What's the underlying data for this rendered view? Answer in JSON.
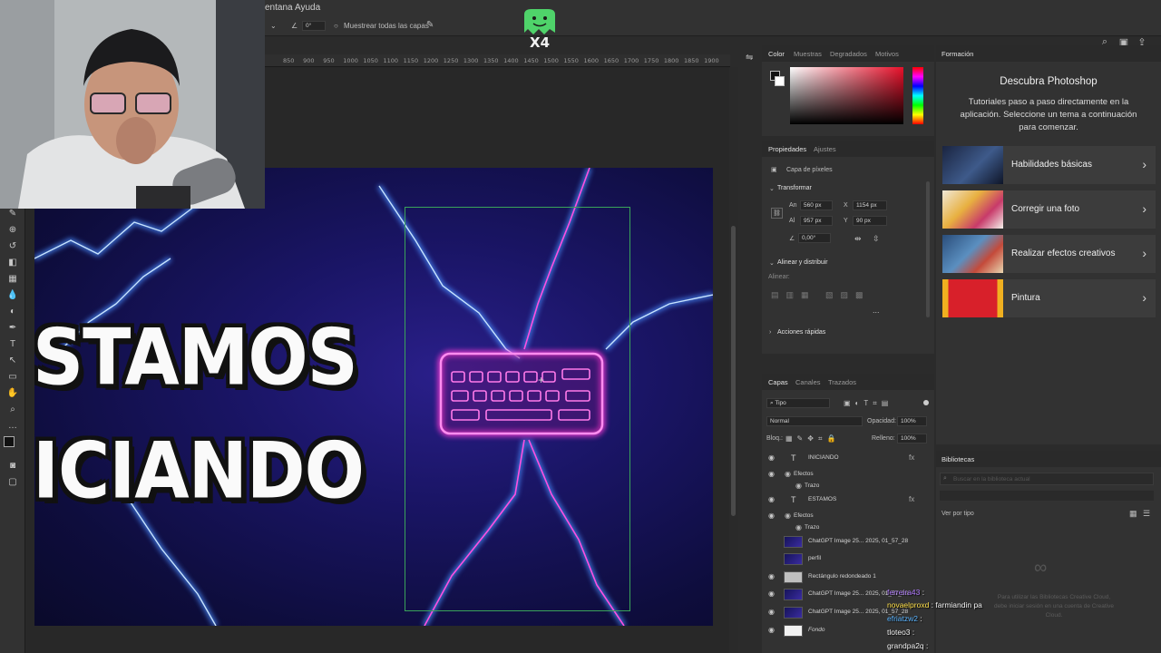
{
  "menu": {
    "items": [
      "entana",
      "Ayuda"
    ]
  },
  "options": {
    "angle": "0°",
    "sample_all_layers": "Muestrear todas las capas"
  },
  "overlay": {
    "badge": "X4"
  },
  "ruler": {
    "ticks": [
      "850",
      "900",
      "950",
      "1000",
      "1050",
      "1100",
      "1150",
      "1200",
      "1250",
      "1300",
      "1350",
      "1400",
      "1450",
      "1500",
      "1550",
      "1600",
      "1650",
      "1700",
      "1750",
      "1800",
      "1850",
      "1900"
    ]
  },
  "canvas": {
    "line1": "STAMOS",
    "line2": "ICIANDO"
  },
  "color_panel": {
    "tabs": [
      "Color",
      "Muestras",
      "Degradados",
      "Motivos"
    ]
  },
  "properties": {
    "tabs": [
      "Propiedades",
      "Ajustes"
    ],
    "layer_kind": "Capa de píxeles",
    "transform_title": "Transformar",
    "an_label": "An",
    "an": "560 px",
    "x_label": "X",
    "x": "1154 px",
    "al_label": "Al",
    "al": "957 px",
    "y_label": "Y",
    "y": "90 px",
    "angle": "0,00°",
    "align_title": "Alinear y distribuir",
    "align_label": "Alinear:",
    "more": "...",
    "quick_actions": "Acciones rápidas"
  },
  "learn": {
    "tab": "Formación",
    "title": "Descubra Photoshop",
    "description": "Tutoriales paso a paso directamente en la aplicación. Seleccione un tema a continuación para comenzar.",
    "cards": [
      {
        "label": "Habilidades básicas"
      },
      {
        "label": "Corregir una foto"
      },
      {
        "label": "Realizar efectos creativos"
      },
      {
        "label": "Pintura"
      }
    ]
  },
  "layers": {
    "tabs": [
      "Capas",
      "Canales",
      "Trazados"
    ],
    "filter": "Tipo",
    "blend": "Normal",
    "opacity_label": "Opacidad:",
    "opacity": "100%",
    "lock_label": "Bloq.:",
    "fill_label": "Relleno:",
    "fill": "100%",
    "items": [
      {
        "name": "INICIANDO",
        "kind": "text"
      },
      {
        "name": "Efectos",
        "kind": "fx"
      },
      {
        "name": "Trazo",
        "kind": "fxitem"
      },
      {
        "name": "ESTAMOS",
        "kind": "text"
      },
      {
        "name": "Efectos",
        "kind": "fx"
      },
      {
        "name": "Trazo",
        "kind": "fxitem"
      },
      {
        "name": "ChatGPT Image 25... 2025, 01_57_28",
        "kind": "image"
      },
      {
        "name": "perfil",
        "kind": "image"
      },
      {
        "name": "Rectángulo redondeado 1",
        "kind": "shape"
      },
      {
        "name": "ChatGPT Image 25... 2025, 01_57_28",
        "kind": "image"
      },
      {
        "name": "ChatGPT Image 25... 2025, 01_57_28",
        "kind": "image"
      },
      {
        "name": "Fondo",
        "kind": "bg"
      }
    ]
  },
  "libraries": {
    "tab": "Bibliotecas",
    "search_placeholder": "Buscar en la biblioteca actual",
    "view_by": "Ver por tipo",
    "signin": "Para utilizar las Bibliotecas Creative Cloud, debe iniciar sesión en una cuenta de Creative Cloud."
  },
  "chat": [
    {
      "user": "ferreira43",
      "msg": ""
    },
    {
      "user": "novaelproxd",
      "msg": "farmiandin pa"
    },
    {
      "user": "efriatzw2",
      "msg": ""
    },
    {
      "user": "tloteo3",
      "msg": ""
    },
    {
      "user": "grandpa2q",
      "msg": ""
    }
  ],
  "colors": {
    "accent_green": "#3aa35a",
    "neon_pink": "#ff3ad8",
    "lightning_blue": "#5aa8ff"
  }
}
